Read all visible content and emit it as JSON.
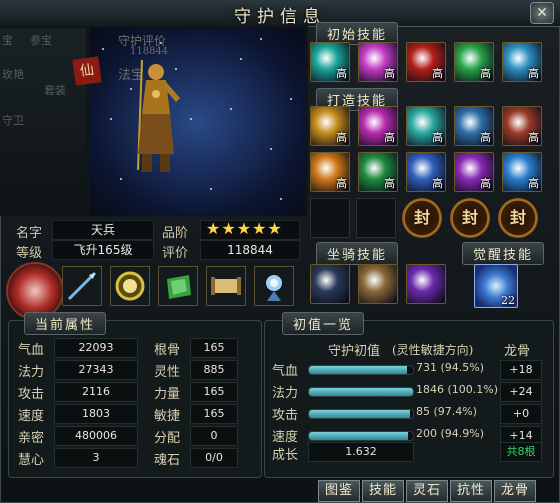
{
  "window": {
    "title": "守护信息",
    "close_glyph": "✕"
  },
  "ghost": {
    "tab1": "宝",
    "tab2": "参宝",
    "left1": "玫艳",
    "left2": "套装",
    "left3": "守卫",
    "score_label_faded": "守护评价",
    "score_faded": "118844",
    "seal_text": "仙",
    "name_faded": "法宝"
  },
  "sections": {
    "initial_skills": "初始技能",
    "forged_skills": "打造技能",
    "mount_skills": "坐骑技能",
    "awaken_skills": "觉醒技能",
    "attributes": "当前属性",
    "overview": "初值一览"
  },
  "info": {
    "name_label": "名字",
    "name": "天兵",
    "grade_label": "品阶",
    "stars": "★★★★★",
    "level_label": "等级",
    "level": "飞升165级",
    "rating_label": "评价",
    "rating": "118844"
  },
  "skills": {
    "quality": "高",
    "seal_label": "封",
    "awaken_level": "22",
    "initial": [
      {
        "icon": "vortex-skill-icon",
        "color": "#1aa39a"
      },
      {
        "icon": "comet-skill-icon",
        "color": "#c33bc7"
      },
      {
        "icon": "flame-skill-icon",
        "color": "#b41f1b"
      },
      {
        "icon": "burst-skill-icon",
        "color": "#27a34a"
      },
      {
        "icon": "spiral-skill-icon",
        "color": "#2a8fc0"
      }
    ],
    "forged_row1": [
      {
        "icon": "fist-skill-icon",
        "color": "#c48a1b"
      },
      {
        "icon": "demon-skill-icon",
        "color": "#b52ab0"
      },
      {
        "icon": "crystal-skill-icon",
        "color": "#2aa7a0"
      },
      {
        "icon": "fan-skill-icon",
        "color": "#2d6fa8"
      },
      {
        "icon": "cloak-skill-icon",
        "color": "#9a3a2a"
      }
    ],
    "forged_row2": [
      {
        "icon": "shatter-skill-icon",
        "color": "#d0781a"
      },
      {
        "icon": "wisp-skill-icon",
        "color": "#1f8a3f"
      },
      {
        "icon": "ghost-skill-icon",
        "color": "#2f5fbf"
      },
      {
        "icon": "skull-skill-icon",
        "color": "#8a2ab5"
      },
      {
        "icon": "aura-skill-icon",
        "color": "#2a7fd0"
      }
    ],
    "mount": [
      {
        "icon": "bull-skill-icon",
        "color": "#2a3a5a"
      },
      {
        "icon": "armor-skill-icon",
        "color": "#8a6a3a"
      },
      {
        "icon": "sigil-skill-icon",
        "color": "#6a2ab0"
      }
    ]
  },
  "equipment": [
    {
      "icon": "orb-equip-icon",
      "color": "#b43a3a"
    },
    {
      "icon": "spear-equip-icon",
      "color": "#3a6a9a"
    },
    {
      "icon": "mirror-equip-icon",
      "color": "#c8b030"
    },
    {
      "icon": "jade-equip-icon",
      "color": "#3aa040"
    },
    {
      "icon": "scroll-equip-icon",
      "color": "#c8a860"
    },
    {
      "icon": "lotus-equip-icon",
      "color": "#7ab0e0"
    }
  ],
  "attributes": [
    {
      "label": "气血",
      "value": "22093",
      "label2": "根骨",
      "value2": "165"
    },
    {
      "label": "法力",
      "value": "27343",
      "label2": "灵性",
      "value2": "885"
    },
    {
      "label": "攻击",
      "value": "2116",
      "label2": "力量",
      "value2": "165"
    },
    {
      "label": "速度",
      "value": "1803",
      "label2": "敏捷",
      "value2": "165"
    },
    {
      "label": "亲密",
      "value": "480006",
      "label2": "分配",
      "value2": "0"
    },
    {
      "label": "慧心",
      "value": "3",
      "label2": "魂石",
      "value2": "0/0"
    }
  ],
  "overview": {
    "header": "守护初值",
    "direction": "(灵性敏捷方向)",
    "bone_header": "龙骨",
    "rows": [
      {
        "label": "气血",
        "text": "731 (94.5%)",
        "pct": 94.5,
        "bonus": "+18"
      },
      {
        "label": "法力",
        "text": "1846 (100.1%)",
        "pct": 100,
        "bonus": "+24"
      },
      {
        "label": "攻击",
        "text": "85 (97.4%)",
        "pct": 97.4,
        "bonus": "+0"
      },
      {
        "label": "速度",
        "text": "200 (94.9%)",
        "pct": 94.9,
        "bonus": "+14"
      }
    ],
    "growth_label": "成长",
    "growth": "1.632",
    "total": "共8根"
  },
  "buttons": [
    "图鉴",
    "技能",
    "灵石",
    "抗性",
    "龙骨"
  ],
  "colors": {
    "accent_green": "#39d36a",
    "quality_text": "#ffffff",
    "gold": "#ffd54a"
  }
}
